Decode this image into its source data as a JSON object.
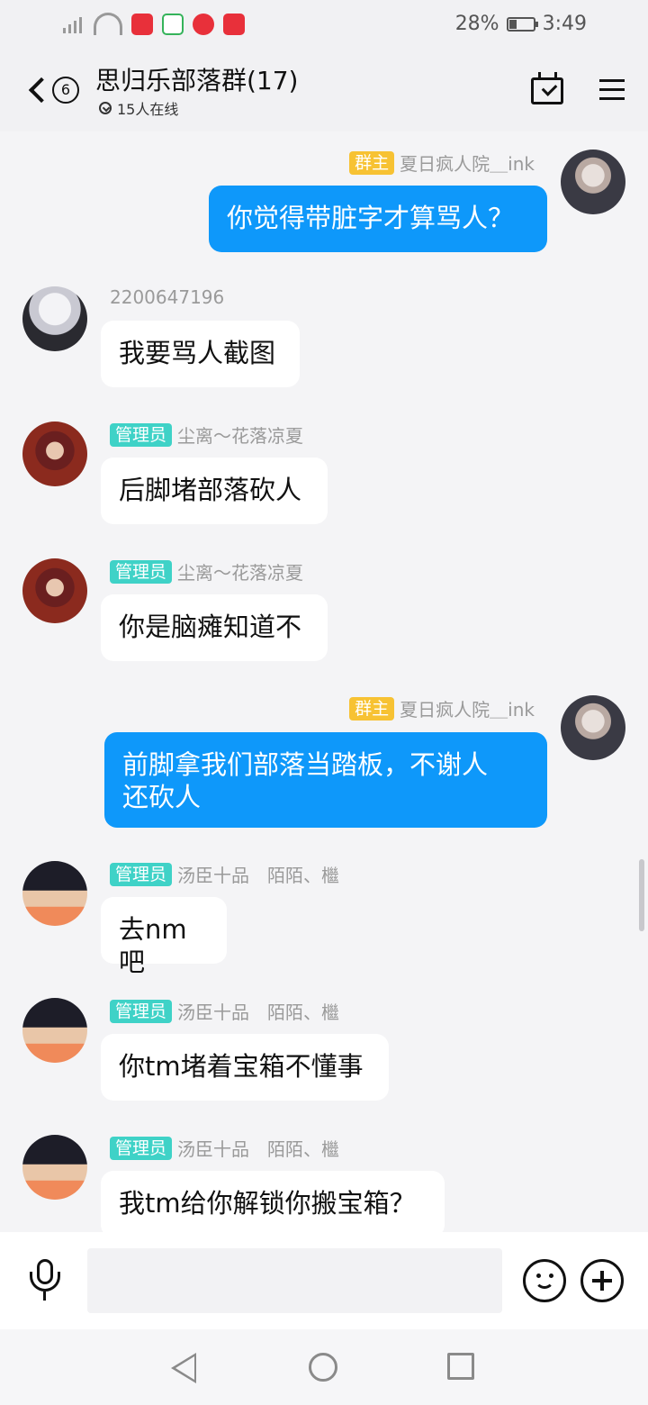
{
  "status_bar": {
    "battery": "28%",
    "time": "3:49",
    "icons": [
      "signal-off-icon",
      "wifi-icon",
      "app-notification-icon",
      "app-notification-icon",
      "app-notification-icon",
      "app-notification-icon"
    ]
  },
  "header": {
    "unread_count": "6",
    "group_title": "思归乐部落群(17)",
    "online_text": "15人在线"
  },
  "colors": {
    "owner_badge": "#f7c233",
    "admin_badge": "#3fd2c7",
    "outgoing_bubble": "#0e98fa",
    "incoming_bubble": "#ffffff"
  },
  "messages": [
    {
      "side": "right",
      "badge": "群主",
      "name": "夏日疯人院＿ink",
      "text": "你觉得带脏字才算骂人？"
    },
    {
      "side": "left",
      "badge": "",
      "name": "2200647196",
      "text": "我要骂人截图"
    },
    {
      "side": "left",
      "badge": "管理员",
      "name": "尘离～花落凉夏",
      "text": "后脚堵部落砍人"
    },
    {
      "side": "left",
      "badge": "管理员",
      "name": "尘离～花落凉夏",
      "text": "你是脑瘫知道不"
    },
    {
      "side": "right",
      "badge": "群主",
      "name": "夏日疯人院＿ink",
      "text": "前脚拿我们部落当踏板，不谢人\n还砍人"
    },
    {
      "side": "left",
      "badge": "管理员",
      "name": "汤臣十品　陌陌、檵",
      "text": "去nm吧"
    },
    {
      "side": "left",
      "badge": "管理员",
      "name": "汤臣十品　陌陌、檵",
      "text": "你tm堵着宝箱不懂事"
    },
    {
      "side": "left",
      "badge": "管理员",
      "name": "汤臣十品　陌陌、檵",
      "text": "我tm给你解锁你搬宝箱？"
    }
  ],
  "input": {
    "value": "",
    "placeholder": ""
  }
}
